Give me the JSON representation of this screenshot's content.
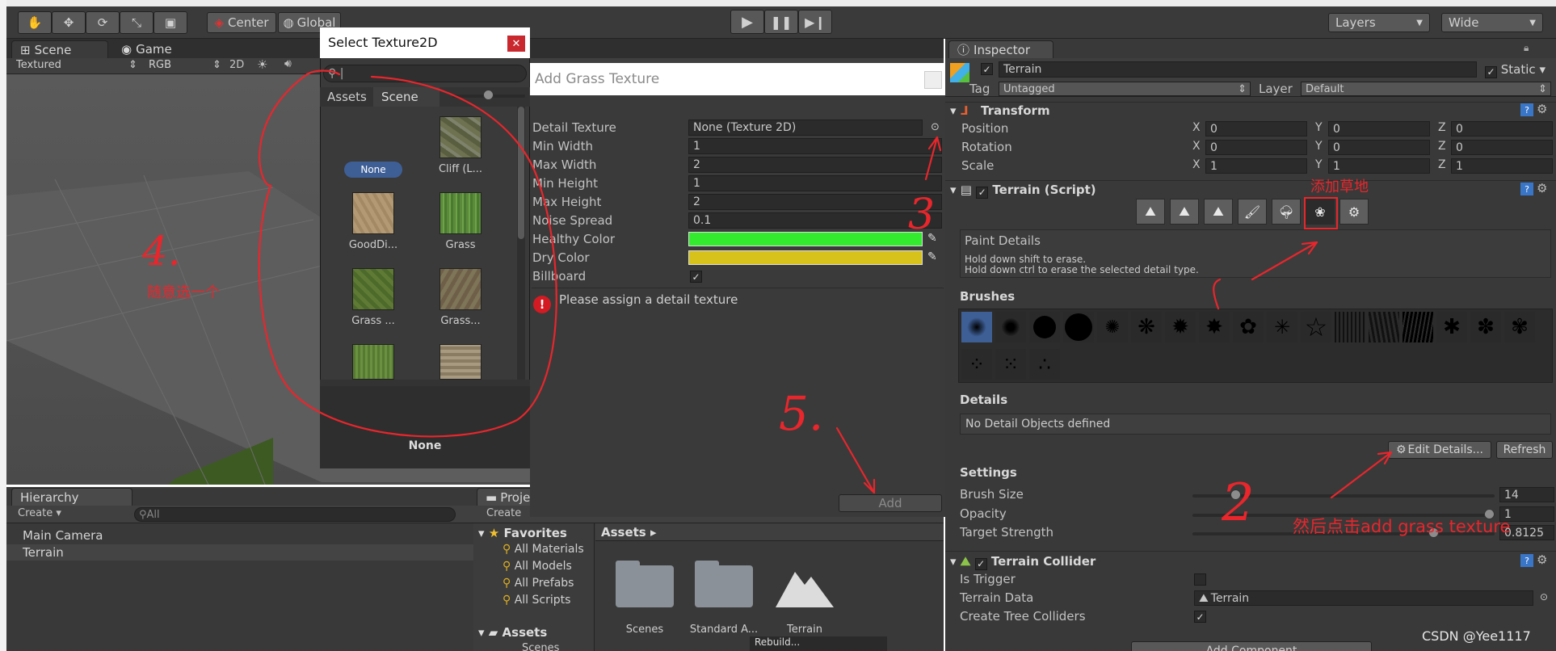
{
  "toolbar": {
    "pivot": "Center",
    "space": "Global",
    "layers": "Layers",
    "layout": "Wide"
  },
  "scene": {
    "tab_scene": "Scene",
    "tab_game": "Game",
    "shading": "Textured",
    "color": "RGB",
    "mode_2d": "2D"
  },
  "texture_picker": {
    "title": "Select Texture2D",
    "tab_assets": "Assets",
    "tab_scene": "Scene",
    "selected": "None",
    "items": [
      "None",
      "Cliff (L...",
      "GoodDi...",
      "Grass",
      "Grass ...",
      "Grass..."
    ]
  },
  "grass_dialog": {
    "title": "Add Grass Texture",
    "fields": [
      {
        "label": "Detail Texture",
        "value": "None (Texture 2D)"
      },
      {
        "label": "Min Width",
        "value": "1"
      },
      {
        "label": "Max Width",
        "value": "2"
      },
      {
        "label": "Min Height",
        "value": "1"
      },
      {
        "label": "Max Height",
        "value": "2"
      },
      {
        "label": "Noise Spread",
        "value": "0.1"
      }
    ],
    "healthy_label": "Healthy Color",
    "dry_label": "Dry Color",
    "billboard_label": "Billboard",
    "warning": "Please assign a detail texture",
    "add_button": "Add",
    "healthy_color": "#33ea2f",
    "dry_color": "#d6c21a"
  },
  "hierarchy": {
    "title": "Hierarchy",
    "create": "Create",
    "search": "All",
    "items": [
      "Main Camera",
      "Terrain"
    ]
  },
  "project": {
    "title": "Proje",
    "create": "Create",
    "favorites": "Favorites",
    "fav_items": [
      "All Materials",
      "All Models",
      "All Prefabs",
      "All Scripts"
    ],
    "assets_header": "Assets",
    "assets_tree": "Assets",
    "assets_sub": "Scenes",
    "asset_items": [
      "Scenes",
      "Standard A...",
      "Terrain"
    ],
    "bottom": "Rebuild..."
  },
  "inspector": {
    "tab": "Inspector",
    "object_name": "Terrain",
    "static": "Static",
    "tag_label": "Tag",
    "tag": "Untagged",
    "layer_label": "Layer",
    "layer": "Default",
    "transform": {
      "title": "Transform",
      "rows": [
        {
          "label": "Position",
          "x": "0",
          "y": "0",
          "z": "0"
        },
        {
          "label": "Rotation",
          "x": "0",
          "y": "0",
          "z": "0"
        },
        {
          "label": "Scale",
          "x": "1",
          "y": "1",
          "z": "1"
        }
      ]
    },
    "terrain_script": "Terrain (Script)",
    "paint_title": "Paint Details",
    "paint_hint1": "Hold down shift to erase.",
    "paint_hint2": "Hold down ctrl to erase the selected detail type.",
    "brushes": "Brushes",
    "details": "Details",
    "no_details": "No Detail Objects defined",
    "edit_details": "Edit Details...",
    "refresh": "Refresh",
    "settings": "Settings",
    "settings_rows": [
      {
        "label": "Brush Size",
        "value": "14",
        "fraction": 0.13
      },
      {
        "label": "Opacity",
        "value": "1",
        "fraction": 1.0
      },
      {
        "label": "Target Strength",
        "value": "0.8125",
        "fraction": 0.81
      }
    ],
    "collider": "Terrain Collider",
    "is_trigger": "Is Trigger",
    "terrain_data": "Terrain Data",
    "terrain_data_value": "Terrain",
    "create_tree": "Create Tree Colliders",
    "add_component": "Add Component"
  },
  "annotations": {
    "add_grass": "添加草地",
    "step2_text": "然后点击add grass texture",
    "step4_text": "随意选一个",
    "n2": "2",
    "n3": "3",
    "n4": "4.",
    "n5": "5."
  },
  "watermark": "CSDN @Yee1117",
  "colors": {
    "accent_red": "#e8262c",
    "panel": "#383838",
    "selected_blue": "#3e5f96"
  }
}
